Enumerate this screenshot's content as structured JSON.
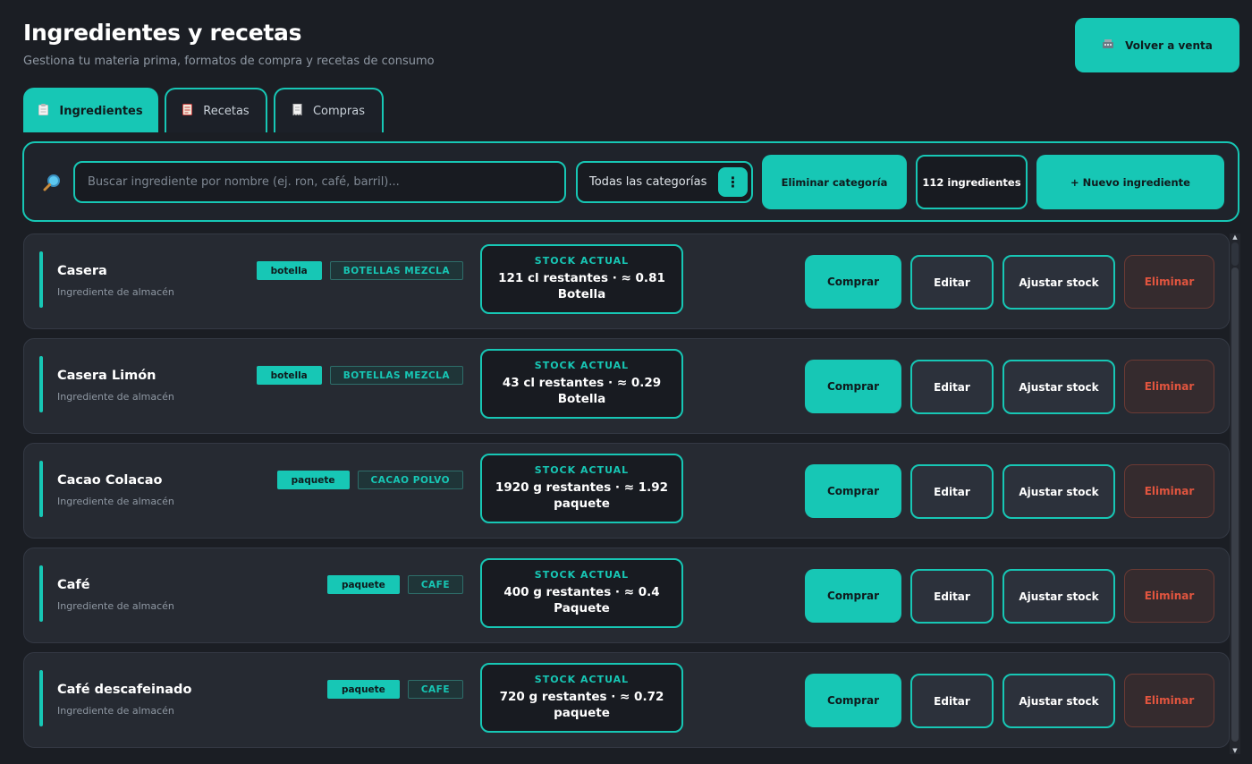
{
  "header": {
    "title": "Ingredientes y recetas",
    "subtitle": "Gestiona tu materia prima, formatos de compra y recetas de consumo",
    "back_label": "Volver a venta",
    "back_icon": "cash-register-icon"
  },
  "tabs": [
    {
      "label": "Ingredientes",
      "icon": "clipboard-icon",
      "active": true
    },
    {
      "label": "Recetas",
      "icon": "recipe-icon",
      "active": false
    },
    {
      "label": "Compras",
      "icon": "receipt-icon",
      "active": false
    }
  ],
  "toolbar": {
    "search_placeholder": "Buscar ingrediente por nombre (ej. ron, café, barril)...",
    "search_value": "",
    "category_selected": "Todas las categorías",
    "delete_category_label": "Eliminar categoría",
    "count_label": "112 ingredientes",
    "new_label": "+ Nuevo ingrediente"
  },
  "stock_title": "STOCK ACTUAL",
  "actions": {
    "buy": "Comprar",
    "edit": "Editar",
    "adjust": "Ajustar stock",
    "delete": "Eliminar"
  },
  "ingredients": [
    {
      "name": "Casera",
      "subtitle": "Ingrediente de almacén",
      "unit": "botella",
      "category": "BOTELLAS MEZCLA",
      "stock": "121 cl restantes  ·  ≈ 0.81 Botella"
    },
    {
      "name": "Casera Limón",
      "subtitle": "Ingrediente de almacén",
      "unit": "botella",
      "category": "BOTELLAS MEZCLA",
      "stock": "43 cl restantes  ·  ≈ 0.29 Botella"
    },
    {
      "name": "Cacao Colacao",
      "subtitle": "Ingrediente de almacén",
      "unit": "paquete",
      "category": "CACAO POLVO",
      "stock": "1920 g restantes  ·  ≈ 1.92 paquete"
    },
    {
      "name": "Café",
      "subtitle": "Ingrediente de almacén",
      "unit": "paquete",
      "category": "CAFE",
      "stock": "400 g restantes  ·  ≈ 0.4 Paquete"
    },
    {
      "name": "Café descafeinado",
      "subtitle": "Ingrediente de almacén",
      "unit": "paquete",
      "category": "CAFE",
      "stock": "720 g restantes  ·  ≈ 0.72 paquete"
    }
  ],
  "colors": {
    "accent": "#17c7b5",
    "background": "#1b1e24",
    "danger": "#e2553f"
  }
}
